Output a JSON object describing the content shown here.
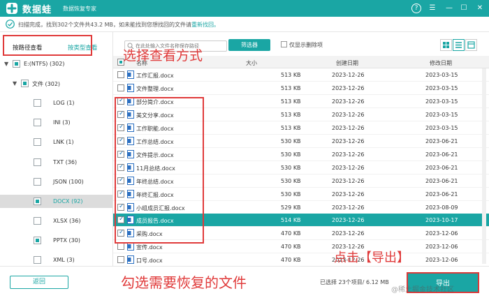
{
  "app": {
    "name": "数据蛙",
    "subtitle": "数据恢复专家",
    "help_label": "?"
  },
  "status": {
    "prefix": "扫描完成，找到302个文件共43.2 MB，如未能找到您想找回的文件请",
    "link": "重新找回。"
  },
  "left": {
    "tab_path": "按路径查看",
    "tab_type": "按类型查看",
    "tree": [
      {
        "label": "E:(NTFS) (302)",
        "arrow": "▼",
        "state": "partial",
        "level": 0
      },
      {
        "label": "文件 (302)",
        "arrow": "▼",
        "state": "partial",
        "level": 1
      },
      {
        "label": "LOG (1)",
        "arrow": "",
        "state": "empty",
        "level": 2
      },
      {
        "label": "INI (3)",
        "arrow": "",
        "state": "empty",
        "level": 2
      },
      {
        "label": "LNK (1)",
        "arrow": "",
        "state": "empty",
        "level": 2
      },
      {
        "label": "TXT (36)",
        "arrow": "",
        "state": "empty",
        "level": 2
      },
      {
        "label": "JSON (100)",
        "arrow": "",
        "state": "empty",
        "level": 2
      },
      {
        "label": "DOCX (92)",
        "arrow": "",
        "state": "partial",
        "level": 2,
        "selected": true
      },
      {
        "label": "XLSX (36)",
        "arrow": "",
        "state": "empty",
        "level": 2
      },
      {
        "label": "PPTX (30)",
        "arrow": "",
        "state": "partial",
        "level": 2
      },
      {
        "label": "XML (3)",
        "arrow": "",
        "state": "empty",
        "level": 2
      }
    ]
  },
  "toolbar": {
    "search_placeholder": "在此处输入文件名称保存路径",
    "filter_label": "筛选器",
    "only_deleted_label": "仅显示删除项"
  },
  "columns": {
    "name": "名称",
    "size": "大小",
    "created": "创建日期",
    "modified": "修改日期"
  },
  "files": [
    {
      "name": "工作汇报.docx",
      "size": "513 KB",
      "created": "2023-12-26",
      "modified": "2023-03-15",
      "checked": false
    },
    {
      "name": "文件整理.docx",
      "size": "513 KB",
      "created": "2023-12-26",
      "modified": "2023-03-15",
      "checked": false
    },
    {
      "name": "部分简介.docx",
      "size": "513 KB",
      "created": "2023-12-26",
      "modified": "2023-03-15",
      "checked": true
    },
    {
      "name": "美文分享.docx",
      "size": "513 KB",
      "created": "2023-12-26",
      "modified": "2023-03-15",
      "checked": true
    },
    {
      "name": "工作职能.docx",
      "size": "513 KB",
      "created": "2023-12-26",
      "modified": "2023-03-15",
      "checked": true
    },
    {
      "name": "工作总结.docx",
      "size": "530 KB",
      "created": "2023-12-26",
      "modified": "2023-06-21",
      "checked": true
    },
    {
      "name": "文件提示.docx",
      "size": "530 KB",
      "created": "2023-12-26",
      "modified": "2023-06-21",
      "checked": true
    },
    {
      "name": "11月总结.docx",
      "size": "530 KB",
      "created": "2023-12-26",
      "modified": "2023-06-21",
      "checked": true
    },
    {
      "name": "年终总结.docx",
      "size": "530 KB",
      "created": "2023-12-26",
      "modified": "2023-06-21",
      "checked": true
    },
    {
      "name": "年终汇报.docx",
      "size": "530 KB",
      "created": "2023-12-26",
      "modified": "2023-06-21",
      "checked": true
    },
    {
      "name": "小组成员汇报.docx",
      "size": "529 KB",
      "created": "2023-12-26",
      "modified": "2023-08-09",
      "checked": true
    },
    {
      "name": "成员报告.docx",
      "size": "514 KB",
      "created": "2023-12-26",
      "modified": "2023-10-17",
      "checked": true,
      "selected": true
    },
    {
      "name": "采购.docx",
      "size": "470 KB",
      "created": "2023-12-26",
      "modified": "2023-12-06",
      "checked": true
    },
    {
      "name": "宣传.docx",
      "size": "470 KB",
      "created": "2023-12-26",
      "modified": "2023-12-06",
      "checked": false
    },
    {
      "name": "口号.docx",
      "size": "470 KB",
      "created": "2023-12-26",
      "modified": "2023-12-06",
      "checked": false
    }
  ],
  "bottom": {
    "back_label": "返回",
    "selected_info": "已选择 23个项目/ 6.12 MB",
    "export_label": "导出",
    "watermark": "@稀土掘金技术社区"
  },
  "annotations": {
    "choose_view": "选择查看方式",
    "check_files": "勾选需要恢复的文件",
    "click_export": "点击【导出】"
  },
  "colors": {
    "accent": "#1aa6a4",
    "annotation": "#e03a3a"
  }
}
